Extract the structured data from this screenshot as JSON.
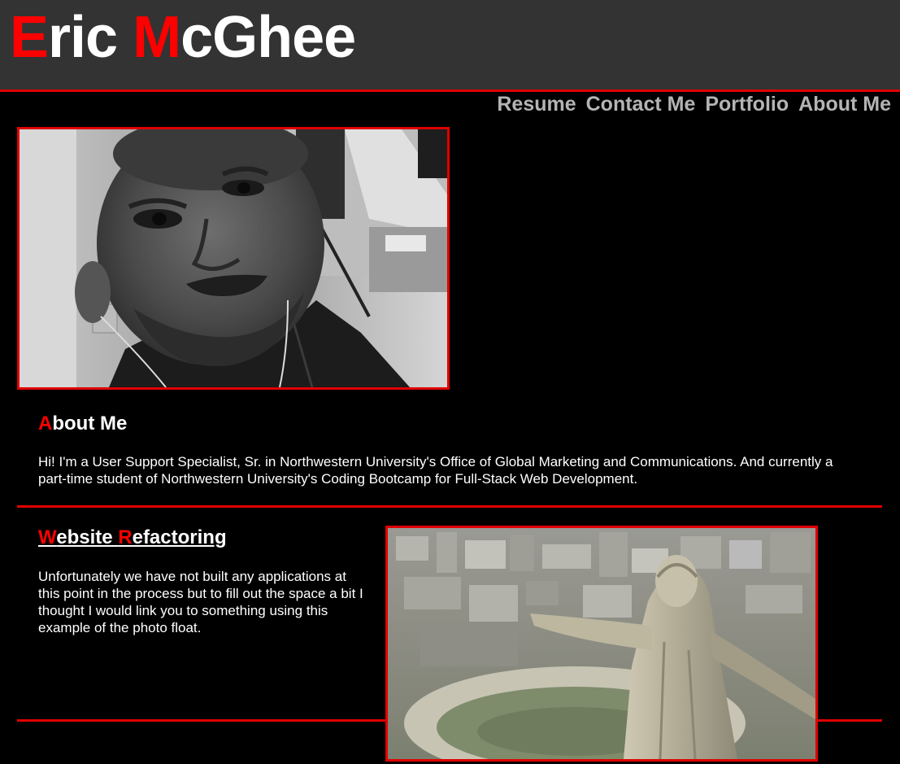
{
  "header": {
    "title_initial_1": "E",
    "title_rest_1": "ric ",
    "title_initial_2": "M",
    "title_rest_2": "cGhee"
  },
  "nav": {
    "items": [
      "Resume",
      "Contact Me",
      "Portfolio",
      "About Me"
    ]
  },
  "about": {
    "heading_initial": "A",
    "heading_rest": "bout Me",
    "text": "Hi! I'm a User Support Specialist, Sr. in Northwestern University's Office of Global Marketing and Communications. And currently a part-time student of Northwestern University's Coding Bootcamp for Full-Stack Web Development."
  },
  "refactor": {
    "heading_initial_1": "W",
    "heading_rest_1": "ebsite ",
    "heading_initial_2": "R",
    "heading_rest_2": "efactoring",
    "text": "Unfortunately we have not built any applications at this point in the process but to fill out the space a bit I thought I would link you to something using this example of the photo float."
  },
  "colors": {
    "accent": "#ff0000",
    "border": "#e00000",
    "header_bg": "#333333",
    "page_bg": "#000000",
    "nav_text": "#b4b4b4"
  }
}
